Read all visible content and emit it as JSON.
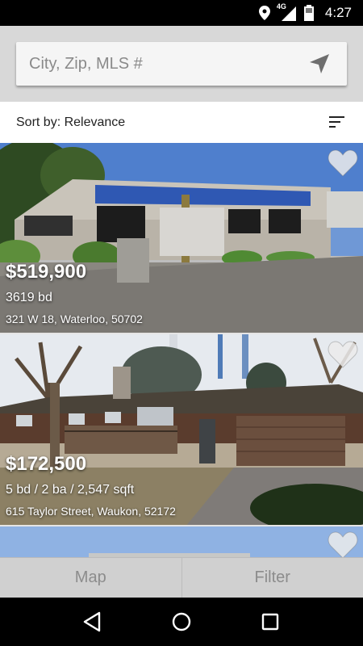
{
  "status_bar": {
    "network": "4G",
    "time": "4:27",
    "icons": [
      "location-icon",
      "signal-icon",
      "battery-icon"
    ]
  },
  "search": {
    "placeholder": "City, Zip, MLS #",
    "icon": "locate-arrow-icon"
  },
  "sort": {
    "label": "Sort by: Relevance",
    "icon": "sort-lines-icon"
  },
  "listings": [
    {
      "price": "$519,900",
      "details": "3619 bd",
      "address": "321 W 18, Waterloo, 50702",
      "favorite_icon": "heart-icon"
    },
    {
      "price": "$172,500",
      "details": "5 bd / 2 ba / 2,547 sqft",
      "address": "615 Taylor Street, Waukon, 52172",
      "favorite_icon": "heart-icon"
    },
    {
      "price": "",
      "details": "",
      "address": "",
      "favorite_icon": "heart-icon"
    }
  ],
  "tabs": [
    {
      "label": "Map"
    },
    {
      "label": "Filter"
    }
  ],
  "nav": [
    "back-icon",
    "home-icon",
    "recents-icon"
  ],
  "colors": {
    "status_bg": "#000000",
    "header_bg": "#d8d8d8",
    "tab_text": "#8c8c8c"
  }
}
